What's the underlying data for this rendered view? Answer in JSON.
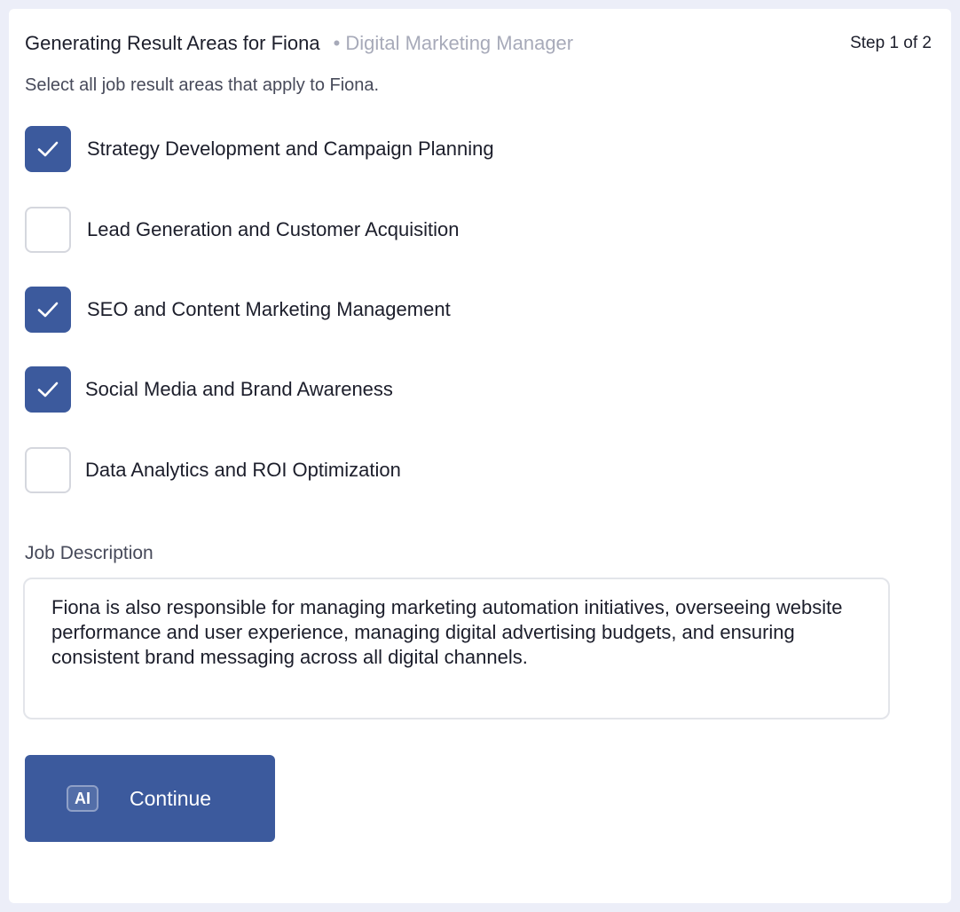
{
  "header": {
    "title": "Generating Result Areas for Fiona",
    "dot": "•",
    "subtitle": "Digital Marketing Manager",
    "step": "Step 1 of 2"
  },
  "instruction": "Select all job result areas that apply to Fiona.",
  "options": [
    {
      "label": "Strategy Development and Campaign Planning",
      "checked": true
    },
    {
      "label": "Lead Generation and Customer Acquisition",
      "checked": false
    },
    {
      "label": "SEO and Content Marketing Management",
      "checked": true
    },
    {
      "label": "Social Media and Brand Awareness",
      "checked": true
    },
    {
      "label": "Data Analytics and ROI Optimization",
      "checked": false
    }
  ],
  "job_description": {
    "label": "Job Description",
    "value": "Fiona is also responsible for managing marketing automation initiatives, overseeing website performance and user experience, managing digital advertising budgets, and ensuring consistent brand messaging across all digital channels."
  },
  "continue_button": {
    "badge": "AI",
    "label": "Continue"
  },
  "colors": {
    "accent": "#3c5a9d",
    "background": "#eceef8",
    "muted_text": "#a7aab9"
  }
}
